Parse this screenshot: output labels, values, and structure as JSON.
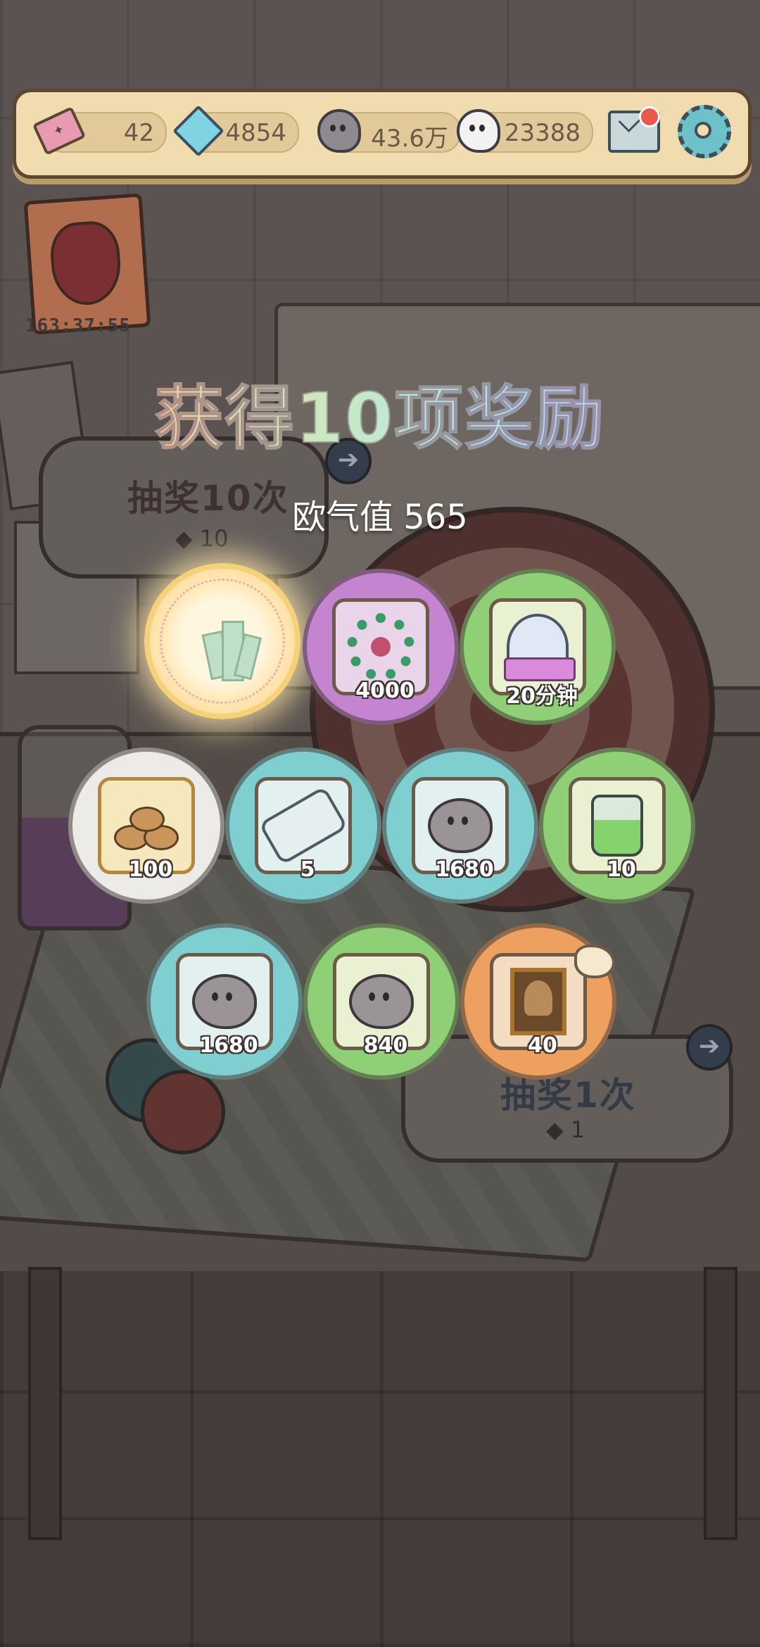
{
  "resources": {
    "tickets": "42",
    "crystals": "4854",
    "dark_souls": "43.6万",
    "white_souls": "23388"
  },
  "event": {
    "timer": "163:37:55"
  },
  "machine": {
    "draw10_label": "抽奖10次",
    "draw10_cost": "10",
    "draw1_label": "抽奖1次",
    "draw1_cost": "1"
  },
  "overlay": {
    "title": "获得10项奖励",
    "luck_label": "欧气值",
    "luck_value": "565"
  },
  "rewards": [
    {
      "item": "crystal-cluster",
      "qty": "",
      "color": "glow"
    },
    {
      "item": "green-wreath",
      "qty": "4000",
      "color": "purple"
    },
    {
      "item": "ghost-pillow",
      "qty": "20分钟",
      "color": "green"
    },
    {
      "item": "firewood",
      "qty": "100",
      "color": "white"
    },
    {
      "item": "scroll",
      "qty": "5",
      "color": "cyan"
    },
    {
      "item": "dark-soul",
      "qty": "1680",
      "color": "cyan"
    },
    {
      "item": "potion-bottle",
      "qty": "10",
      "color": "green"
    },
    {
      "item": "dark-soul",
      "qty": "1680",
      "color": "cyan"
    },
    {
      "item": "dark-soul",
      "qty": "840",
      "color": "green"
    },
    {
      "item": "painting",
      "qty": "40",
      "color": "orange"
    }
  ],
  "colors": {
    "purple": "#c484cf",
    "green": "#8fcf76",
    "cyan": "#7fcfd1",
    "white": "#ecebe8",
    "orange": "#eea061"
  }
}
